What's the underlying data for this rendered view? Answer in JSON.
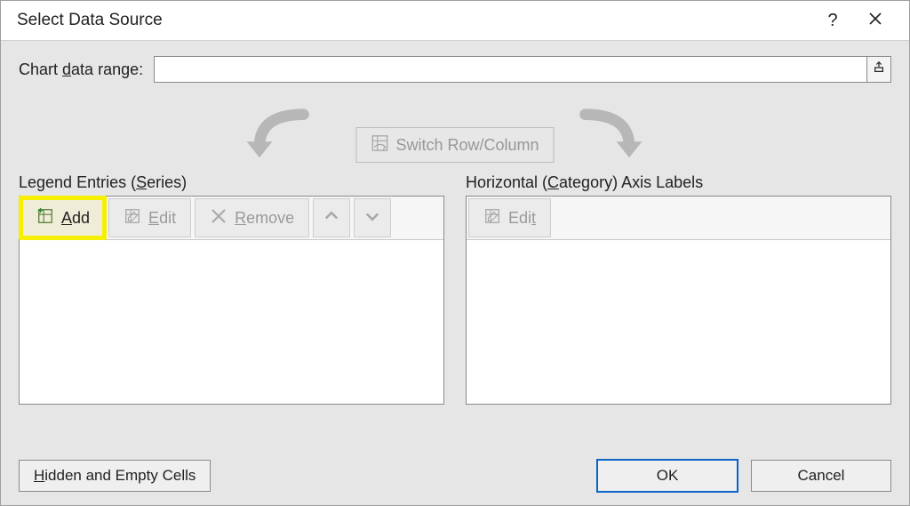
{
  "titlebar": {
    "title": "Select Data Source",
    "help_label": "?",
    "close_label": "Close"
  },
  "range": {
    "label_prefix": "Chart ",
    "label_mnemonic": "d",
    "label_suffix": "ata range:",
    "value": ""
  },
  "switch": {
    "label": "Switch Row/Column"
  },
  "legend_panel": {
    "title_prefix": "Legend Entries (",
    "title_mnemonic": "S",
    "title_suffix": "eries)",
    "add_mnemonic": "A",
    "add_suffix": "dd",
    "edit_mnemonic": "E",
    "edit_suffix": "dit",
    "remove_mnemonic": "R",
    "remove_suffix": "emove"
  },
  "axis_panel": {
    "title_prefix": "Horizontal (",
    "title_mnemonic": "C",
    "title_suffix": "ategory) Axis Labels",
    "edit_label": "Edi",
    "edit_mnemonic": "t"
  },
  "footer": {
    "hidden_mnemonic": "H",
    "hidden_suffix": "idden and Empty Cells",
    "ok": "OK",
    "cancel": "Cancel"
  }
}
